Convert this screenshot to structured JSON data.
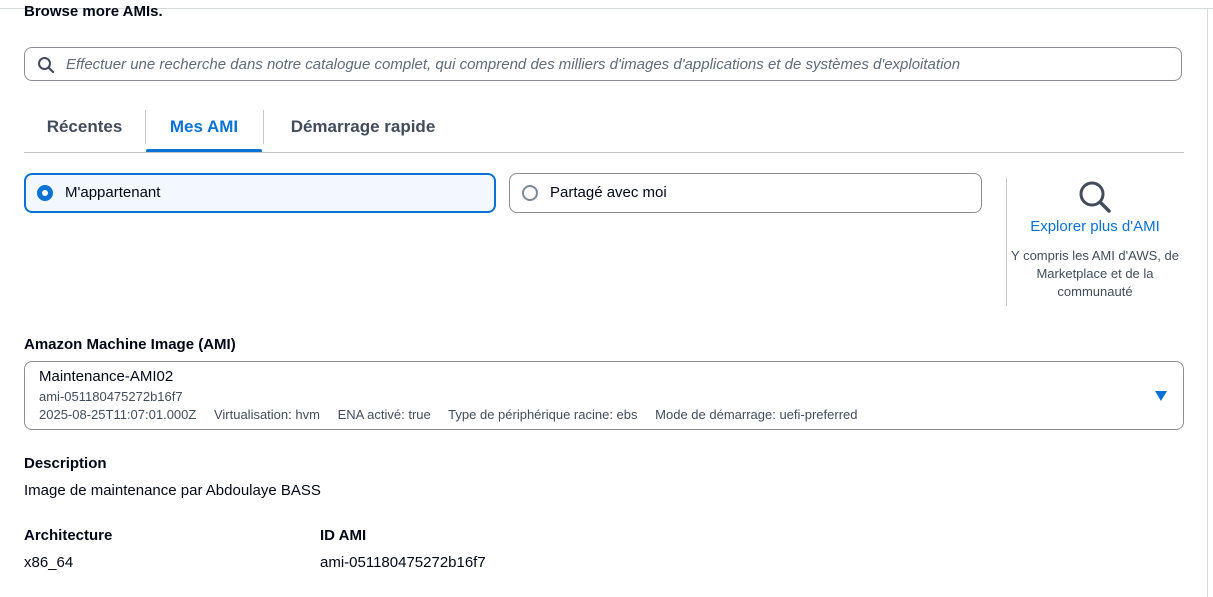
{
  "section": {
    "browse_title": "Browse more AMIs."
  },
  "search": {
    "placeholder": "Effectuer une recherche dans notre catalogue complet, qui comprend des milliers d'images d'applications et de systèmes d'exploitation"
  },
  "tabs": [
    {
      "label": "Récentes",
      "active": false
    },
    {
      "label": "Mes AMI",
      "active": true
    },
    {
      "label": "Démarrage rapide",
      "active": false
    }
  ],
  "ownership": {
    "options": [
      {
        "label": "M'appartenant",
        "selected": true
      },
      {
        "label": "Partagé avec moi",
        "selected": false
      }
    ]
  },
  "explore": {
    "icon": "search-icon",
    "link_label": "Explorer plus d'AMI",
    "description": "Y compris les AMI d'AWS, de Marketplace et de la communauté"
  },
  "ami": {
    "label": "Amazon Machine Image (AMI)",
    "selected_name": "Maintenance-AMI02",
    "selected_id": "ami-051180475272b16f7",
    "tags": [
      "2025-08-25T11:07:01.000Z",
      "Virtualisation: hvm",
      "ENA activé: true",
      "Type de périphérique racine: ebs",
      "Mode de démarrage: uefi-preferred"
    ]
  },
  "details": {
    "description_label": "Description",
    "description_value": "Image de maintenance par Abdoulaye BASS",
    "architecture_label": "Architecture",
    "architecture_value": "x86_64",
    "ami_id_label": "ID AMI",
    "ami_id_value": "ami-051180475272b16f7"
  },
  "colors": {
    "accent": "#0972d3",
    "text": "#000716",
    "secondary_text": "#414d5c",
    "border": "#8c8c94"
  }
}
